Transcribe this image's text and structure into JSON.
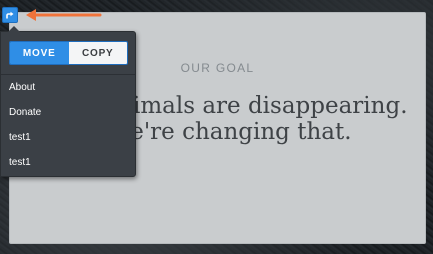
{
  "page": {
    "eyebrow": "OUR GOAL",
    "headline": "Our animals are disappearing. We're changing that."
  },
  "move_menu": {
    "trigger_icon": "move-arrow-icon",
    "segments": {
      "move_label": "MOVE",
      "copy_label": "COPY",
      "selected": "MOVE"
    },
    "items": [
      {
        "label": "About"
      },
      {
        "label": "Donate"
      },
      {
        "label": "test1"
      },
      {
        "label": "test1"
      }
    ]
  },
  "annotation": {
    "icon": "orange-pointer-arrow-icon",
    "color": "#f0733a"
  },
  "colors": {
    "accent": "#2f8ee6",
    "menu_bg": "#3b4046",
    "card_bg": "#c9ccce"
  }
}
